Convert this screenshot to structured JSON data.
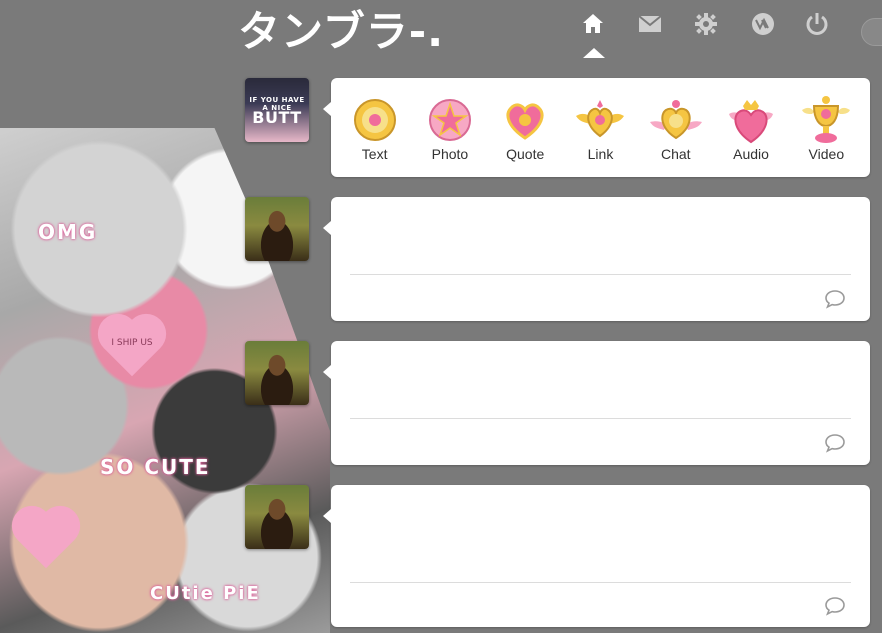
{
  "header": {
    "logo": "タンブラ-.",
    "nav": [
      {
        "name": "home-icon",
        "active": true
      },
      {
        "name": "mail-icon"
      },
      {
        "name": "gear-icon"
      },
      {
        "name": "activity-icon"
      },
      {
        "name": "power-icon"
      }
    ]
  },
  "collage": {
    "omg": "OMG",
    "ship": "I SHIP US",
    "so_cute": "SO CUTE",
    "cutie_pie": "CUtie PiE",
    "avatar_caption_small": "IF YOU HAVE A NICE",
    "avatar_caption_big": "BUTT"
  },
  "post_types": [
    {
      "label": "Text",
      "icon": "brooch-round-icon"
    },
    {
      "label": "Photo",
      "icon": "brooch-star-icon"
    },
    {
      "label": "Quote",
      "icon": "brooch-heart-icon"
    },
    {
      "label": "Link",
      "icon": "brooch-winged-heart-icon"
    },
    {
      "label": "Chat",
      "icon": "brooch-crystal-icon"
    },
    {
      "label": "Audio",
      "icon": "brooch-crown-heart-icon"
    },
    {
      "label": "Video",
      "icon": "chalice-icon"
    }
  ],
  "colors": {
    "background": "#7a7a7a",
    "card": "#ffffff",
    "accent_pink": "#f06c9b",
    "accent_gold": "#f5c542"
  }
}
